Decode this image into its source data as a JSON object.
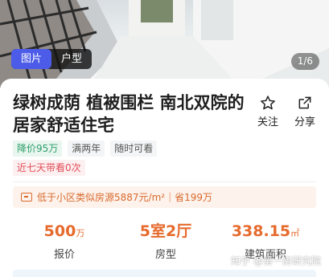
{
  "media": {
    "tabs": [
      {
        "label": "图片",
        "active": true
      },
      {
        "label": "户型",
        "active": false
      }
    ],
    "counter": "1/6"
  },
  "listing": {
    "title": "绿树成荫 植被围栏 南北双院的居家舒适住宅",
    "actions": {
      "follow": {
        "label": "关注",
        "icon": "star-icon"
      },
      "share": {
        "label": "分享",
        "icon": "share-icon"
      }
    },
    "tags": [
      "降价95万",
      "满两年",
      "随时可看"
    ],
    "visit_tag": "近七天带看0次",
    "price_banner": "低于小区类似房源5887元/m²｜省199万"
  },
  "stats": [
    {
      "value": "500",
      "unit": "万",
      "label": "报价"
    },
    {
      "value": "5室2厅",
      "unit": "",
      "label": "房型"
    },
    {
      "value": "338.15",
      "unit": "㎡",
      "label": "建筑面积"
    }
  ],
  "watermark": "知乎 @第一房研究院",
  "colors": {
    "accent_blue": "#4c5ce8",
    "price_orange": "#e66a2c",
    "tag_green": "#2e9f6a",
    "tag_red": "#e24d58"
  }
}
